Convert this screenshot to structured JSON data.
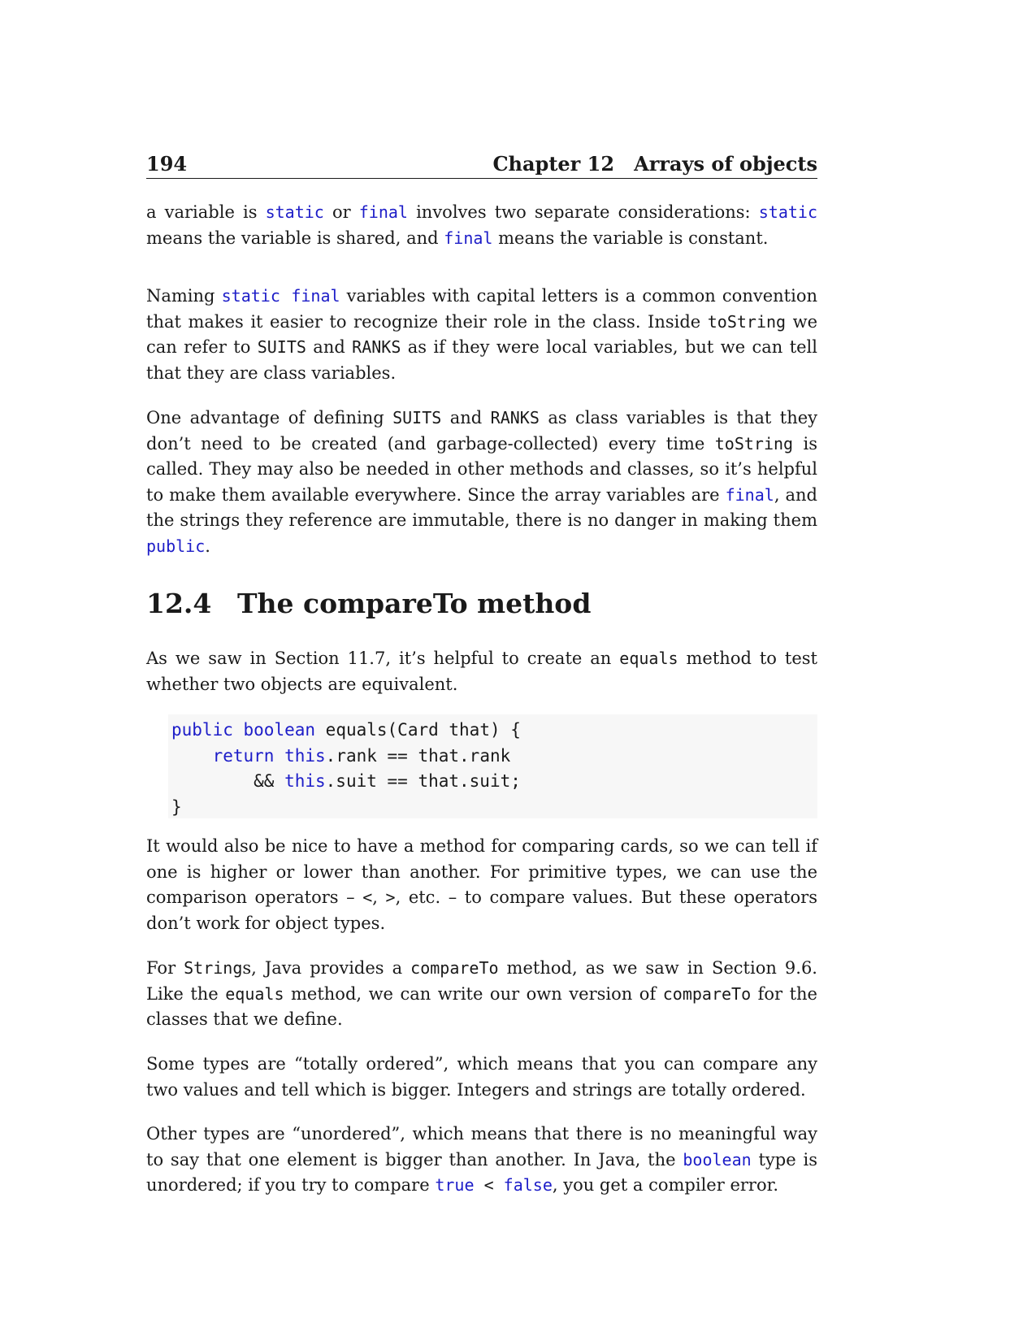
{
  "header": {
    "page_number": "194",
    "chapter_label": "Chapter 12",
    "chapter_title": "Arrays of objects"
  },
  "p1": {
    "t1": "a variable is ",
    "c1": "static",
    "t2": " or ",
    "c2": "final",
    "t3": " involves two separate considerations: ",
    "c3": "static",
    "t4": " means the variable is shared, and ",
    "c4": "final",
    "t5": " means the variable is constant."
  },
  "p2": {
    "t1": "Naming ",
    "c1": "static final",
    "t2": " variables with capital letters is a common convention that makes it easier to recognize their role in the class. Inside ",
    "c2": "toString",
    "t3": " we can refer to ",
    "c3": "SUITS",
    "t4": " and ",
    "c4": "RANKS",
    "t5": " as if they were local variables, but we can tell that they are class variables."
  },
  "p3": {
    "t1": "One advantage of defining ",
    "c1": "SUITS",
    "t2": " and ",
    "c2": "RANKS",
    "t3": " as class variables is that they don’t need to be created (and garbage-collected) every time ",
    "c3": "toString",
    "t4": " is called. They may also be needed in other methods and classes, so it’s helpful to make them available everywhere. Since the array variables are ",
    "c4": "final",
    "t5": ", and the strings they reference are immutable, there is no danger in making them ",
    "c5": "public",
    "t6": "."
  },
  "section": {
    "number": "12.4",
    "title": "The compareTo method"
  },
  "p4": {
    "t1": "As we saw in Section 11.7, it’s helpful to create an ",
    "c1": "equals",
    "t2": " method to test whether two objects are equivalent."
  },
  "code": {
    "l1_kw1": "public",
    "l1_sp": " ",
    "l1_kw2": "boolean",
    "l1_rest": " equals(Card that) {",
    "l2_indent": "    ",
    "l2_kw1": "return",
    "l2_sp": " ",
    "l2_kw2": "this",
    "l2_rest": ".rank == that.rank",
    "l3_indent": "        && ",
    "l3_kw": "this",
    "l3_rest": ".suit == that.suit;",
    "l4": "}"
  },
  "p5": {
    "t1": "It would also be nice to have a method for comparing cards, so we can tell if one is higher or lower than another. For primitive types, we can use the comparison operators – ",
    "c1": "<",
    "t2": ", ",
    "c2": ">",
    "t3": ", etc. – to compare values. But these operators don’t work for object types."
  },
  "p6": {
    "t1": "For ",
    "c1": "String",
    "t2": "s, Java provides a ",
    "c2": "compareTo",
    "t3": " method, as we saw in Section 9.6. Like the ",
    "c3": "equals",
    "t4": " method, we can write our own version of ",
    "c4": "compareTo",
    "t5": " for the classes that we define."
  },
  "p7": {
    "t1": "Some types are “totally ordered”, which means that you can compare any two values and tell which is bigger. Integers and strings are totally ordered."
  },
  "p8": {
    "t1": "Other types are “unordered”, which means that there is no meaningful way to say that one element is bigger than another. In Java, the ",
    "c1": "boolean",
    "t2": " type is unordered; if you try to compare ",
    "c2": "true",
    "t3": " ",
    "c3": "<",
    "t4": " ",
    "c4": "false",
    "t5": ", you get a compiler error."
  }
}
